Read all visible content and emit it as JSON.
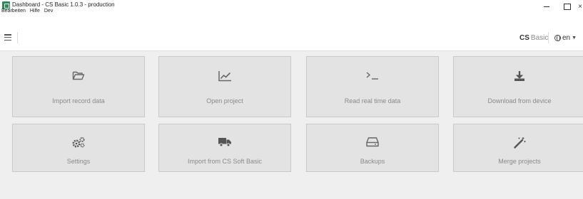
{
  "window": {
    "title": "Dashboard - CS Basic 1.0.3 - production",
    "close_glyph": "×"
  },
  "menu": {
    "items": [
      "Bearbeiten",
      "Hilfe",
      "Dev"
    ]
  },
  "header": {
    "brand_strong": "CS",
    "brand_light": "Basic",
    "language": "en"
  },
  "tiles": [
    {
      "label": "Import record data",
      "icon": "folder-open-icon"
    },
    {
      "label": "Open project",
      "icon": "line-chart-icon"
    },
    {
      "label": "Read real time data",
      "icon": "terminal-icon"
    },
    {
      "label": "Download from device",
      "icon": "download-icon"
    },
    {
      "label": "Settings",
      "icon": "gears-icon"
    },
    {
      "label": "Import from CS Soft Basic",
      "icon": "truck-icon"
    },
    {
      "label": "Backups",
      "icon": "hard-drive-icon"
    },
    {
      "label": "Merge projects",
      "icon": "magic-wand-icon"
    }
  ],
  "colors": {
    "tile_bg": "#e3e3e3",
    "tile_border": "#c9c9c9",
    "content_bg": "#efefef",
    "label": "#8a8a8a",
    "icon": "#666666",
    "app_icon": "#2e8b57"
  }
}
